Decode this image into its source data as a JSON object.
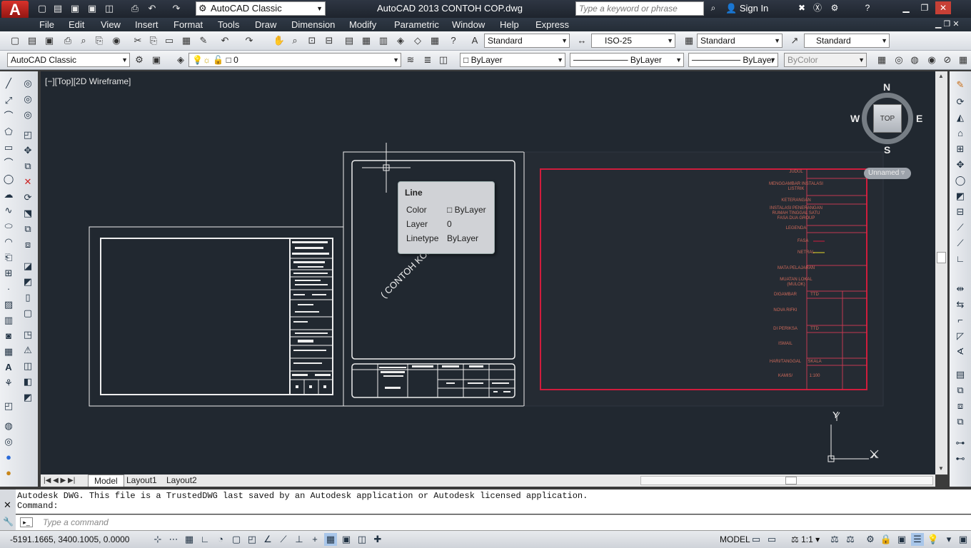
{
  "app": {
    "logo_letter": "A",
    "workspace": "AutoCAD Classic",
    "title": "AutoCAD 2013    CONTOH COP.dwg",
    "search_placeholder": "Type a keyword or phrase",
    "sign_in": "Sign In"
  },
  "menu": [
    "File",
    "Edit",
    "View",
    "Insert",
    "Format",
    "Tools",
    "Draw",
    "Dimension",
    "Modify",
    "Parametric",
    "Window",
    "Help",
    "Express"
  ],
  "toolbar1": {
    "text_style": "Standard",
    "dim_style": "ISO-25",
    "table_style": "Standard",
    "mleader_style": "Standard"
  },
  "toolbar2": {
    "workspace": "AutoCAD Classic",
    "layer": "0",
    "color": "ByLayer",
    "linetype": "ByLayer",
    "lineweight": "ByLayer",
    "plotstyle": "ByColor"
  },
  "viewport": {
    "label": "[−][Top][2D Wireframe]",
    "viewcube": {
      "top": "TOP",
      "n": "N",
      "s": "S",
      "e": "E",
      "w": "W",
      "ucs": "Unnamed"
    },
    "ucs_y": "Y",
    "ucs_x": "X"
  },
  "drawing": {
    "rotated_text": "( CONTOH KOP ETIKET GAMBAR )",
    "kop": {
      "judul": "JUDUL",
      "judul_val": "MENGGAMBAR INSTALASI LISTRIK",
      "keterangan": "KETERANGAN",
      "keterangan_val": "INSTALASI PENERANGAN RUMAH TINGGAL SATU FASA DUA GROUP",
      "legenda": "LEGENDA",
      "fasa": "FASA",
      "netral": "NETRAL",
      "mata": "MATA PELAJARAN",
      "mata_val": "MUATAN LOKAL (MULOK)",
      "digambar": "DIGAMBAR",
      "ttd1": "TTD",
      "nama1": "NOVA RIFKI",
      "diperiksa": "DI PERIKSA",
      "ttd2": "TTD",
      "nama2": "ISMAIL",
      "hari": "HARI/TANGGAL",
      "skala": "SKALA",
      "hari_val": "KAMIS/",
      "skala_val": "1:100"
    }
  },
  "tooltip": {
    "title": "Line",
    "color_label": "Color",
    "color_value": "ByLayer",
    "layer_label": "Layer",
    "layer_value": "0",
    "linetype_label": "Linetype",
    "linetype_value": "ByLayer"
  },
  "layout_tabs": [
    "Model",
    "Layout1",
    "Layout2"
  ],
  "command": {
    "history_line1": "Autodesk DWG.  This file is a TrustedDWG last saved by an Autodesk application or Autodesk licensed application.",
    "history_line2": "Command:",
    "placeholder": "Type a command"
  },
  "status": {
    "coords": "-5191.1665, 3400.1005, 0.0000",
    "model": "MODEL",
    "scale": "1:1"
  }
}
